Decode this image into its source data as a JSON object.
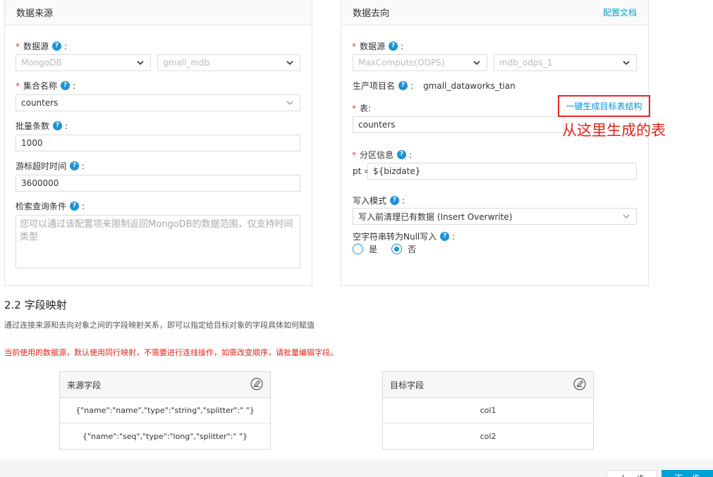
{
  "source": {
    "title": "数据来源",
    "datasource_label": "数据源",
    "datasource_type": "MongoDB",
    "datasource_name": "gmall_mdb",
    "collection_label": "集合名称",
    "collection_value": "counters",
    "batch_label": "批量条数",
    "batch_value": "1000",
    "cursor_timeout_label": "游标超时时间",
    "cursor_timeout_value": "3600000",
    "query_label": "检索查询条件",
    "query_placeholder": "您可以通过该配置项来限制返回MongoDB的数据范围，仅支持时间类型"
  },
  "target": {
    "title": "数据去向",
    "doc_link": "配置文档",
    "datasource_label": "数据源",
    "datasource_type": "MaxCompute(ODPS)",
    "datasource_name": "mdb_odps_1",
    "project_label": "生产项目名",
    "project_value": "gmall_dataworks_tian",
    "table_label": "表:",
    "table_value": "counters",
    "generate_link": "一键生成目标表结构",
    "partition_label": "分区信息",
    "partition_prefix": "pt =",
    "partition_value": "${bizdate}",
    "write_mode_label": "写入模式",
    "write_mode_value": "写入前清理已有数据 (Insert Overwrite)",
    "null_label": "空字符串转为Null写入",
    "null_yes": "是",
    "null_no": "否"
  },
  "annotation": "从这里生成的表",
  "mapping": {
    "section_title": "2.2 字段映射",
    "description": "通过连接来源和去向对象之间的字段映射关系，即可以指定给目标对象的字段具体如何赋值",
    "warning": "当前使用的数据源，默认使用同行映射，不需要进行连线操作，如需改变顺序，请批量编辑字段。",
    "source_header": "来源字段",
    "target_header": "目标字段",
    "source_rows": [
      "{\"name\":\"name\",\"type\":\"string\",\"splitter\":\" \"}",
      "{\"name\":\"seq\",\"type\":\"long\",\"splitter\":\" \"}"
    ],
    "target_rows": [
      "col1",
      "col2"
    ]
  },
  "footer": {
    "prev_label": "上一步",
    "next_label": "下一步"
  },
  "colors": {
    "accent": "#1f92d6",
    "link": "#00a1d6",
    "warning": "#e2231a"
  }
}
